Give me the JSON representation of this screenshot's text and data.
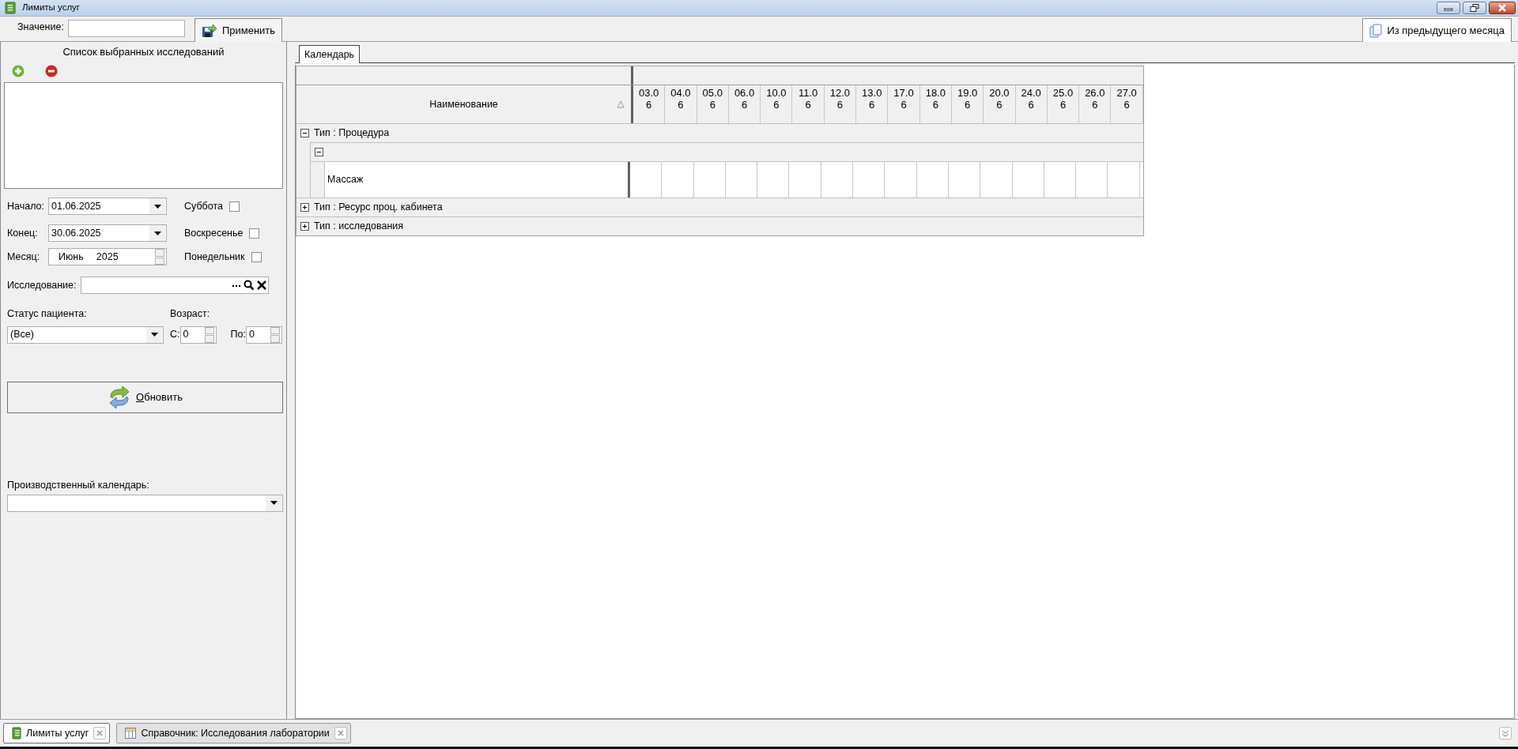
{
  "window": {
    "title": "Лимиты услуг"
  },
  "toolbar": {
    "value_label": "Значение:",
    "apply_button": "Применить",
    "copy_button": "Из предыдущего месяца"
  },
  "selected_list": {
    "title": "Список выбранных исследований"
  },
  "filters": {
    "start": {
      "label": "Начало:",
      "value": "01.06.2025"
    },
    "end": {
      "label": "Конец:",
      "value": "30.06.2025"
    },
    "month": {
      "label": "Месяц:",
      "month": "Июнь",
      "year": "2025"
    },
    "weekdays": [
      {
        "label": "Суббота",
        "checked": false
      },
      {
        "label": "Воскресенье",
        "checked": false
      },
      {
        "label": "Понедельник",
        "checked": false
      }
    ],
    "study": {
      "label": "Исследование:"
    },
    "patient_status": {
      "label": "Статус пациента:",
      "value": "(Все)"
    },
    "age": {
      "label": "Возраст:",
      "from_label": "С:",
      "from": "0",
      "to_label": "По:",
      "to": "0"
    }
  },
  "refresh_button": "Обновить",
  "production_calendar": {
    "label": "Производственный календарь:"
  },
  "tabs": [
    {
      "label": "Календарь",
      "selected": true
    }
  ],
  "grid": {
    "name_column": "Наименование",
    "date_columns": [
      "03.06",
      "04.06",
      "05.06",
      "06.06",
      "10.06",
      "11.06",
      "12.06",
      "13.06",
      "17.06",
      "18.06",
      "19.06",
      "20.06",
      "24.06",
      "25.06",
      "26.06",
      "27.06"
    ],
    "groups": [
      {
        "label": "Тип : Процедура",
        "expanded": true,
        "children": [
          {
            "expanded": true,
            "rows": [
              {
                "name": "Массаж"
              }
            ]
          }
        ]
      },
      {
        "label": "Тип : Ресурс проц. кабинета",
        "expanded": false
      },
      {
        "label": "Тип : исследования",
        "expanded": false
      }
    ]
  },
  "document_tabs": [
    {
      "label": "Лимиты услуг",
      "selected": true,
      "kind": "form"
    },
    {
      "label": "Справочник: Исследования лаборатории",
      "selected": false,
      "kind": "table"
    }
  ]
}
